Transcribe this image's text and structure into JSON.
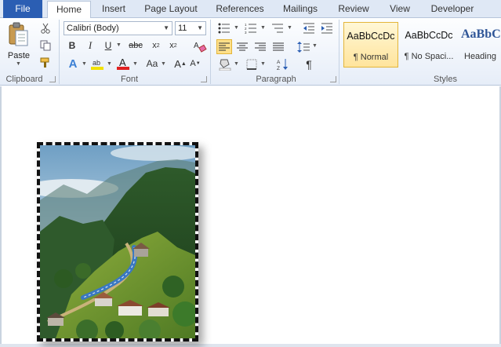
{
  "tabs": {
    "file": "File",
    "home": "Home",
    "insert": "Insert",
    "page_layout": "Page Layout",
    "references": "References",
    "mailings": "Mailings",
    "review": "Review",
    "view": "View",
    "developer": "Developer"
  },
  "clipboard": {
    "paste_label": "Paste",
    "group_label": "Clipboard"
  },
  "font": {
    "family": "Calibri (Body)",
    "size": "11",
    "group_label": "Font"
  },
  "paragraph": {
    "group_label": "Paragraph"
  },
  "styles": {
    "group_label": "Styles",
    "items": [
      {
        "sample": "AaBbCcDc",
        "name": "¶ Normal"
      },
      {
        "sample": "AaBbCcDc",
        "name": "¶ No Spaci..."
      },
      {
        "sample": "AaBbC",
        "name": "Heading"
      }
    ]
  },
  "colors": {
    "file_tab": "#2b5eb3",
    "highlight": "#f2e100",
    "font_color": "#e02020",
    "heading_style": "#2f5597"
  }
}
